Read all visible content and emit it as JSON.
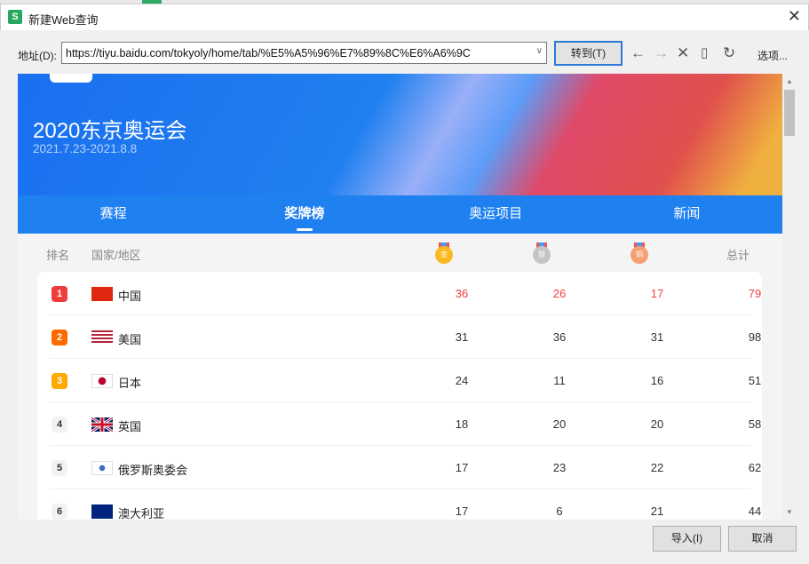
{
  "window": {
    "title": "新建Web查询",
    "app_icon": "S",
    "close": "✕"
  },
  "toolbar": {
    "address_label": "地址(D):",
    "address_value": "https://tiyu.baidu.com/tokyoly/home/tab/%E5%A5%96%E7%89%8C%E6%A6%9C",
    "go_label": "转到(T)",
    "options_label": "选项..."
  },
  "banner": {
    "title": "2020东京奥运会",
    "dates": "2021.7.23-2021.8.8"
  },
  "tabs": [
    {
      "label": "赛程"
    },
    {
      "label": "奖牌榜"
    },
    {
      "label": "奥运项目"
    },
    {
      "label": "新闻"
    }
  ],
  "table": {
    "headers": {
      "rank": "排名",
      "country": "国家/地区",
      "gold": "金",
      "silver": "银",
      "bronze": "铜",
      "total": "总计"
    },
    "rows": [
      {
        "rank": "1",
        "country": "中国",
        "gold": "36",
        "silver": "26",
        "bronze": "17",
        "total": "79"
      },
      {
        "rank": "2",
        "country": "美国",
        "gold": "31",
        "silver": "36",
        "bronze": "31",
        "total": "98"
      },
      {
        "rank": "3",
        "country": "日本",
        "gold": "24",
        "silver": "11",
        "bronze": "16",
        "total": "51"
      },
      {
        "rank": "4",
        "country": "英国",
        "gold": "18",
        "silver": "20",
        "bronze": "20",
        "total": "58"
      },
      {
        "rank": "5",
        "country": "俄罗斯奥委会",
        "gold": "17",
        "silver": "23",
        "bronze": "22",
        "total": "62"
      },
      {
        "rank": "6",
        "country": "澳大利亚",
        "gold": "17",
        "silver": "6",
        "bronze": "21",
        "total": "44"
      }
    ]
  },
  "footer": {
    "import_label": "导入(I)",
    "cancel_label": "取消"
  },
  "colors": {
    "accent": "#1f80f0",
    "rank1": "#f03c3c",
    "rank2": "#ff6a00",
    "rank3": "#ffaa00",
    "highlight": "#f04040"
  }
}
